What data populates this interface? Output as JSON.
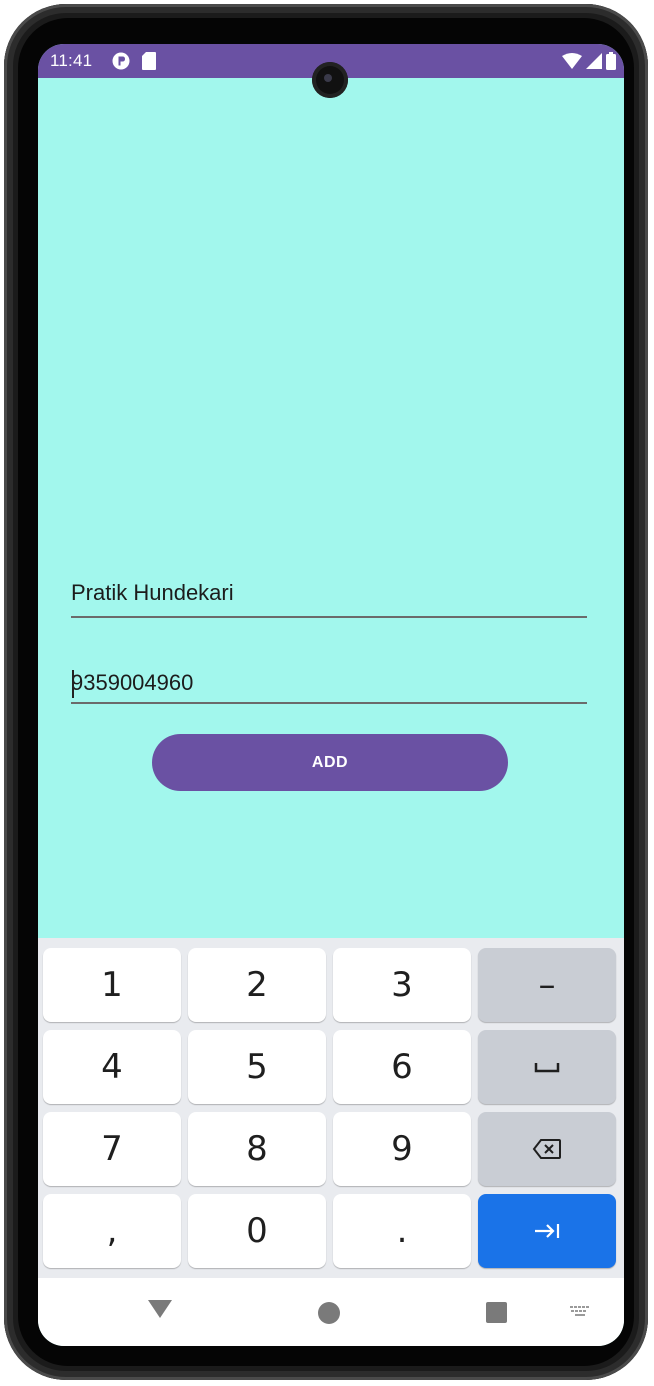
{
  "status_bar": {
    "time": "11:41",
    "icons": [
      "app-notification-icon",
      "sd-card-icon",
      "wifi-icon",
      "signal-icon",
      "battery-icon"
    ],
    "color": "#6a51a3"
  },
  "form": {
    "name_value": "Pratik Hundekari",
    "phone_value": "9359004960",
    "add_label": "ADD",
    "background": "#a2f7ed",
    "accent": "#6a51a3"
  },
  "keyboard": {
    "keys": {
      "k1": "1",
      "k2": "2",
      "k3": "3",
      "k4": "4",
      "k5": "5",
      "k6": "6",
      "k7": "7",
      "k8": "8",
      "k9": "9",
      "comma": ",",
      "k0": "0",
      "period": ".",
      "minus": "–"
    },
    "function_icons": [
      "space-icon",
      "backspace-icon",
      "next-tab-icon"
    ],
    "action_color": "#1a73e8"
  },
  "nav_bar": {
    "icons": [
      "back-icon",
      "home-icon",
      "recents-icon",
      "keyboard-switch-icon"
    ]
  }
}
